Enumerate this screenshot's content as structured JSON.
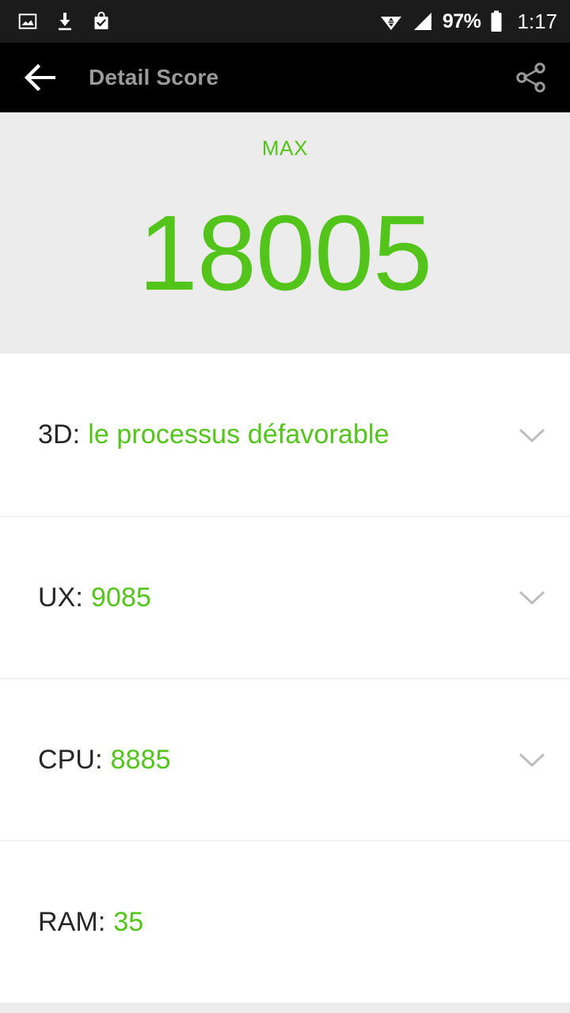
{
  "statusbar": {
    "icons_left": [
      "image-icon",
      "download-icon",
      "shopping-bag-check-icon"
    ],
    "wifi_icon": "wifi-data-transfer-icon",
    "signal_icon": "cell-signal-icon",
    "battery_percent": "97%",
    "battery_icon": "battery-full-icon",
    "clock": "1:17"
  },
  "appbar": {
    "back_icon": "back-arrow-icon",
    "title": "Detail Score",
    "share_icon": "share-icon",
    "title_color": "#9b9b9b",
    "background_color": "#000000"
  },
  "hero": {
    "label": "MAX",
    "score": "18005",
    "accent_color": "#52c41a",
    "background_color": "#ececec"
  },
  "rows": [
    {
      "label": "3D:",
      "value": "le processus défavorable",
      "chevron_icon": "chevron-down-icon",
      "has_chevron": true
    },
    {
      "label": "UX:",
      "value": "9085",
      "chevron_icon": "chevron-down-icon",
      "has_chevron": true
    },
    {
      "label": "CPU:",
      "value": "8885",
      "chevron_icon": "chevron-down-icon",
      "has_chevron": true
    },
    {
      "label": "RAM:",
      "value": "35",
      "chevron_icon": "chevron-down-icon",
      "has_chevron": false
    }
  ]
}
